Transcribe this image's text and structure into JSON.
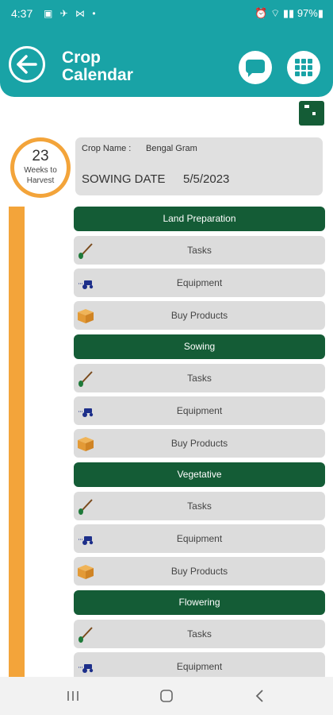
{
  "status_bar": {
    "time": "4:37",
    "left_icons": "▣ ✈ ⋈ •",
    "right": "⏰ ⌔ ▮▮ 97%▮"
  },
  "header": {
    "title": "Crop Calendar",
    "back_icon": "arrow-left-icon",
    "chat_icon": "chat-bubble-icon",
    "menu_icon": "grid-menu-icon"
  },
  "save_icon": "save-icon",
  "weeks": {
    "number": "23",
    "label": "Weeks to Harvest"
  },
  "crop": {
    "name_label": "Crop Name :",
    "name": "Bengal Gram",
    "sowing_label": "SOWING DATE",
    "sowing_date": "5/5/2023"
  },
  "stages": [
    {
      "name": "Land Preparation",
      "items": [
        "Tasks",
        "Equipment",
        "Buy Products"
      ]
    },
    {
      "name": "Sowing",
      "items": [
        "Tasks",
        "Equipment",
        "Buy Products"
      ]
    },
    {
      "name": "Vegetative",
      "items": [
        "Tasks",
        "Equipment",
        "Buy Products"
      ]
    },
    {
      "name": "Flowering",
      "items": [
        "Tasks",
        "Equipment"
      ]
    }
  ],
  "colors": {
    "teal": "#19a3a6",
    "dark_green": "#145c36",
    "orange": "#f3a43a",
    "card_gray": "#dcdcdc"
  }
}
